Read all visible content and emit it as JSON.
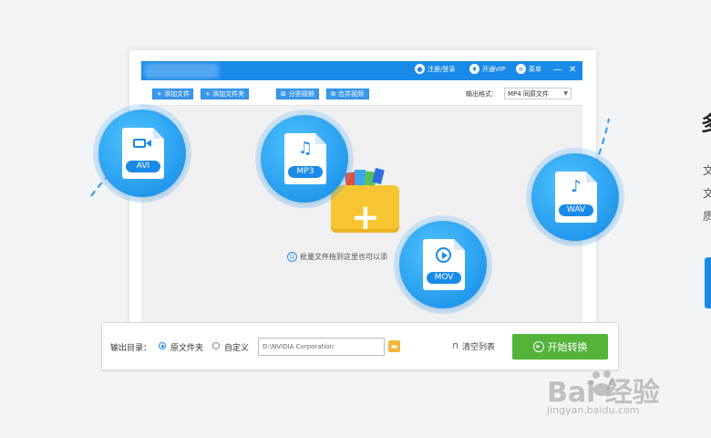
{
  "window": {
    "titlebar": {
      "register_label": "注册/登录",
      "vip_label": "开通VIP",
      "menu_label": "菜单",
      "minimize_glyph": "—",
      "close_glyph": "✕"
    },
    "toolbar": {
      "add_file_label": "+ 添加文件",
      "add_folder_label": "+ 添加文件夹",
      "split_label": "分割视频",
      "merge_label": "合并视频",
      "output_format_label": "输出格式：",
      "output_format_value": "MP4  同原文件"
    },
    "droparea": {
      "hint": "批量文件拖到这里也可以添"
    }
  },
  "bottom": {
    "output_dir_label": "输出目录：",
    "option_source_label": "原文件夹",
    "option_custom_label": "自定义",
    "path_value": "D:\\NVIDIA Corporation",
    "clear_label": "清空列表",
    "start_label": "开始转换",
    "selected_option": "原文件夹"
  },
  "formats": [
    {
      "tag": "AVI",
      "icon": "video-camera-icon"
    },
    {
      "tag": "MP3",
      "icon": "music-note-icon"
    },
    {
      "tag": "MOV",
      "icon": "play-circle-icon"
    },
    {
      "tag": "WAV",
      "icon": "music-note-icon"
    }
  ],
  "edge": {
    "title": "多",
    "line1": "文",
    "line2": "文",
    "line3": "质"
  },
  "watermark": {
    "logo": "Bai  经验",
    "url": "jingyan.baidu.com"
  },
  "colors": {
    "primary": "#1a8ae8",
    "start_button": "#54b43a",
    "folder": "#f7c531"
  }
}
